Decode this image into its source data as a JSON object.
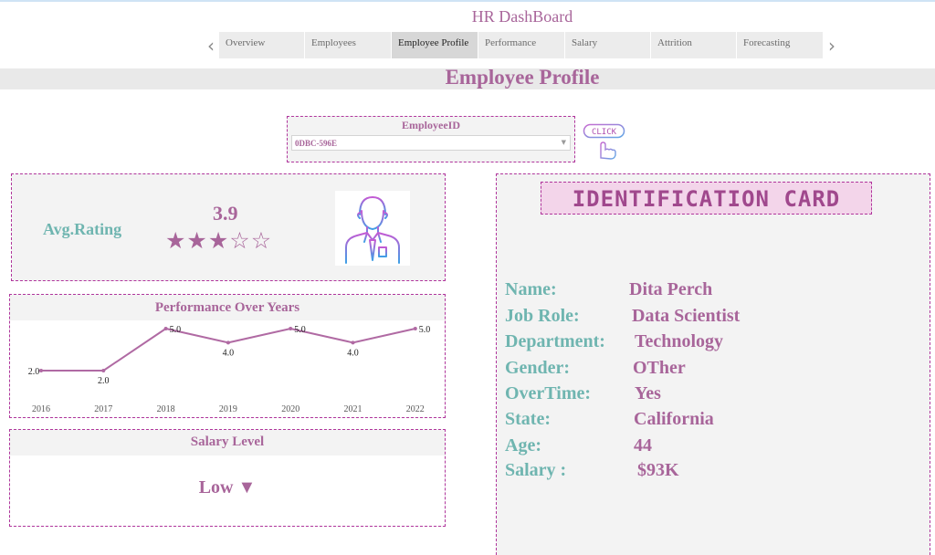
{
  "app": {
    "title": "HR DashBoard"
  },
  "tabs": [
    {
      "label": "Overview",
      "active": false
    },
    {
      "label": "Employees",
      "active": false
    },
    {
      "label": "Employee Profile",
      "active": true
    },
    {
      "label": "Performance",
      "active": false
    },
    {
      "label": "Salary",
      "active": false
    },
    {
      "label": "Attrition",
      "active": false
    },
    {
      "label": "Forecasting",
      "active": false
    }
  ],
  "page": {
    "title": "Employee Profile"
  },
  "filter": {
    "label": "EmployeeID",
    "value": "0DBC-596E"
  },
  "click_button": {
    "label": "CLICK"
  },
  "rating": {
    "label": "Avg.Rating",
    "value": "3.9",
    "stars_filled": 3,
    "stars_total": 5
  },
  "performance": {
    "title": "Performance Over Years"
  },
  "chart_data": {
    "type": "line",
    "title": "Performance Over Years",
    "x": [
      "2016",
      "2017",
      "2018",
      "2019",
      "2020",
      "2021",
      "2022"
    ],
    "series": [
      {
        "values": [
          2.0,
          2.0,
          5.0,
          4.0,
          5.0,
          4.0,
          5.0
        ]
      }
    ],
    "ylim": [
      2.0,
      5.0
    ],
    "grid": false,
    "color": "#b06aa3"
  },
  "salary": {
    "title": "Salary Level",
    "level": "Low ▼"
  },
  "id_card": {
    "title": "IDENTIFICATION CARD",
    "fields": [
      {
        "key": "Name:",
        "value": "Dita Perch"
      },
      {
        "key": "Job Role:",
        "value": "Data Scientist"
      },
      {
        "key": "Department:",
        "value": "Technology"
      },
      {
        "key": "Gender:",
        "value": "OTher"
      },
      {
        "key": "OverTime:",
        "value": "Yes"
      },
      {
        "key": "State:",
        "value": "California"
      },
      {
        "key": "Age:",
        "value": "44"
      },
      {
        "key": "Salary :",
        "value": "$93K"
      }
    ]
  },
  "colors": {
    "accent": "#a8659a",
    "teal": "#6fb5b0",
    "border": "#b0359c",
    "panel_bg": "#f3f3f3"
  }
}
